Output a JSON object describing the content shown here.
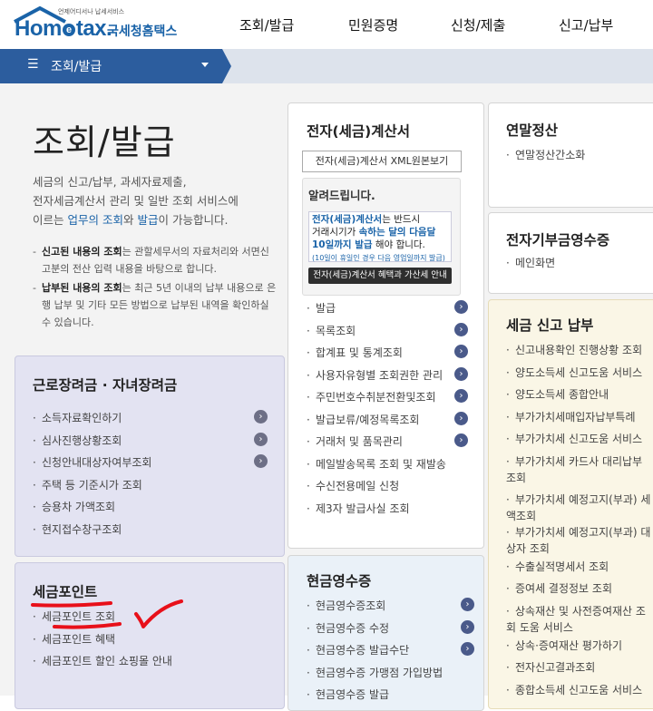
{
  "header": {
    "logo_small": "언제어디서나 납세서비스",
    "logo_brand_pre": "Hom",
    "logo_brand_e": "e",
    "logo_brand_post": "tax.",
    "logo_kr": "국세청홈택스",
    "nav": [
      "조회/발급",
      "민원증명",
      "신청/제출",
      "신고/납부"
    ]
  },
  "breadcrumb": {
    "menu_icon": "☰",
    "title": "조회/발급"
  },
  "page": {
    "title": "조회/발급",
    "desc_line1": "세금의 신고/납부, 과세자료제출,",
    "desc_line2": "전자세금계산서 관리 및 일반 조회 서비스에",
    "desc_line3_a": "이르는 ",
    "desc_line3_b": "업무의 조회",
    "desc_line3_c": "와 ",
    "desc_line3_d": "발급",
    "desc_line3_e": "이 가능합니다.",
    "bullet1_bold": "신고된 내용의 조회",
    "bullet1_text": "는 관할세무서의 자료처리와 서면신고분의 전산 입력 내용을 바탕으로 합니다.",
    "bullet2_bold": "납부된 내용의 조회",
    "bullet2_text": "는 최근 5년 이내의 납부 내용으로 은행 납부 및 기타 모든 방법으로 납부된 내역을 확인하실 수 있습니다."
  },
  "earned": {
    "title": "근로장려금 · 자녀장려금",
    "items": [
      "소득자료확인하기",
      "심사진행상황조회",
      "신청안내대상자여부조회",
      "주택 등 기준시가 조회",
      "승용차 가액조회",
      "현지접수창구조회"
    ]
  },
  "taxpoint": {
    "title": "세금포인트",
    "items": [
      "세금포인트 조회",
      "세금포인트 혜택",
      "세금포인트 할인 쇼핑몰 안내"
    ]
  },
  "einvoice": {
    "title": "전자(세금)계산서",
    "xml_button": "전자(세금)계산서 XML원본보기",
    "notice_title": "알려드립니다.",
    "notice_t1": "전자(세금)계산서",
    "notice_t2": "는 반드시",
    "notice_t3": "거래시기가 ",
    "notice_t4": "속하는 달의 다음달",
    "notice_t5": "10일까지 발급",
    "notice_t6": " 해야 합니다.",
    "notice_small": "(10일이 휴일인 경우 다음 영업일까지 발급)",
    "notice_button": "전자(세금)계산서 혜택과 가산세 안내",
    "items": [
      "발급",
      "목록조회",
      "합계표 및 통계조회",
      "사용자유형별 조회권한 관리",
      "주민번호수취분전환및조회",
      "발급보류/예정목록조회",
      "거래처 및 품목관리",
      "메일발송목록 조회 및 재발송",
      "수신전용메일 신청",
      "제3자 발급사실 조회"
    ]
  },
  "cash": {
    "title": "현금영수증",
    "items": [
      "현금영수증조회",
      "현금영수증 수정",
      "현금영수증 발급수단",
      "현금영수증 가맹점 가입방법",
      "현금영수증 발급"
    ]
  },
  "yearend": {
    "title": "연말정산",
    "items": [
      "연말정산간소화"
    ]
  },
  "evat": {
    "title": "전자기부금영수증",
    "items": [
      "메인화면"
    ]
  },
  "taxreport": {
    "title": "세금 신고 납부",
    "items": [
      "신고내용확인 진행상황 조회",
      "양도소득세 신고도움 서비스",
      "양도소득세 종합안내",
      "부가가치세매입자납부특례",
      "부가가치세 신고도움 서비스",
      "부가가치세 카드사 대리납부 조회",
      "부가가치세 예정고지(부과) 세액조회",
      "부가가치세 예정고지(부과) 대상자 조회",
      "수출실적명세서 조회",
      "증여세 결정정보 조회",
      "상속재산 및 사전증여재산 조회 도움 서비스",
      "상속·증여재산 평가하기",
      "전자신고결과조회",
      "종합소득세 신고도움 서비스"
    ]
  },
  "colors": {
    "brand_blue": "#1a63a8",
    "bar_blue": "#2c5d9e",
    "annotation_red": "#e8101a"
  }
}
